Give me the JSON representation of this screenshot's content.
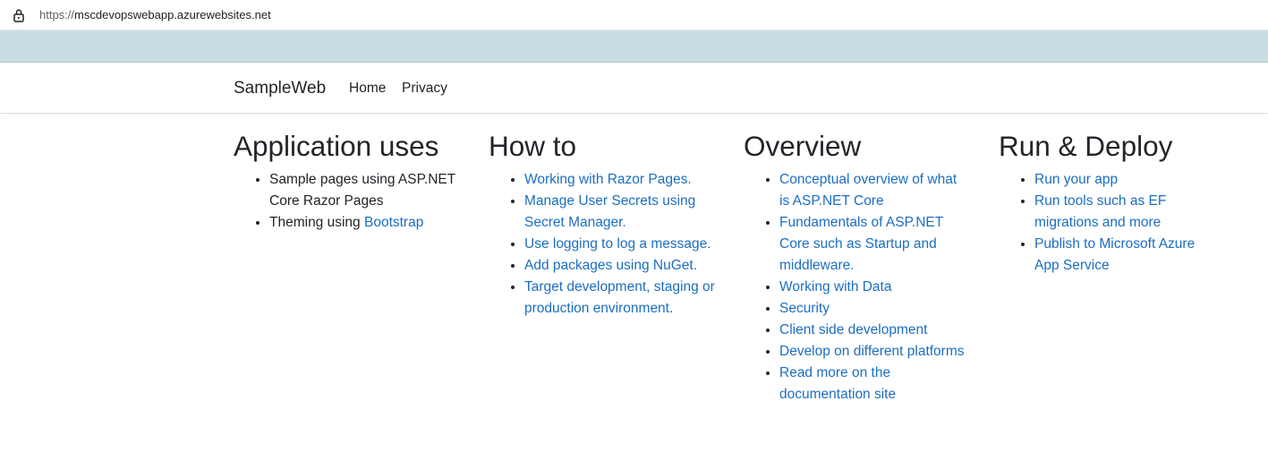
{
  "browser": {
    "url_scheme": "https://",
    "url_host": "mscdevopswebapp.azurewebsites.net",
    "lock_icon": "lock-icon"
  },
  "navbar": {
    "brand": "SampleWeb",
    "links": [
      "Home",
      "Privacy"
    ]
  },
  "columns": {
    "application_uses": {
      "title": "Application uses",
      "item1": "Sample pages using ASP.NET Core Razor Pages",
      "item2_prefix": "Theming using ",
      "item2_link": "Bootstrap"
    },
    "how_to": {
      "title": "How to",
      "items": [
        "Working with Razor Pages.",
        "Manage User Secrets using Secret Manager.",
        "Use logging to log a message.",
        "Add packages using NuGet.",
        "Target development, staging or production environment."
      ]
    },
    "overview": {
      "title": "Overview",
      "items": [
        "Conceptual overview of what is ASP.NET Core",
        "Fundamentals of ASP.NET Core such as Startup and middleware.",
        "Working with Data",
        "Security",
        "Client side development",
        "Develop on different platforms",
        "Read more on the documentation site"
      ]
    },
    "run_deploy": {
      "title": "Run & Deploy",
      "items": [
        "Run your app",
        "Run tools such as EF migrations and more",
        "Publish to Microsoft Azure App Service"
      ]
    }
  },
  "colors": {
    "link": "#1b6ec2",
    "text": "#212529",
    "chrome_band": "#c7dfe3"
  }
}
